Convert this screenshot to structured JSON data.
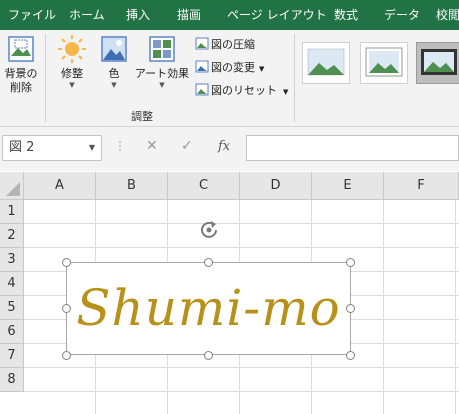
{
  "tabs": [
    "ファイル",
    "ホーム",
    "挿入",
    "描画",
    "ページ レイアウト",
    "数式",
    "データ",
    "校閲"
  ],
  "ribbon": {
    "remove_background": [
      "背景の",
      "削除"
    ],
    "corrections": "修整",
    "color": "色",
    "artistic_effects": "アート効果",
    "compress_pictures": "図の圧縮",
    "change_picture": "図の変更",
    "reset_picture": "図のリセット",
    "group_label": "調整"
  },
  "formula_bar": {
    "name_box": "図 2",
    "fx": "fx"
  },
  "columns": [
    "A",
    "B",
    "C",
    "D",
    "E",
    "F"
  ],
  "rows": [
    "1",
    "2",
    "3",
    "4",
    "5",
    "6",
    "7",
    "8"
  ],
  "picture": {
    "text": "Shumi-mo",
    "text_color": "#b8911a"
  },
  "colors": {
    "tab_bar": "#217346",
    "ribbon": "#f3f3f3"
  }
}
